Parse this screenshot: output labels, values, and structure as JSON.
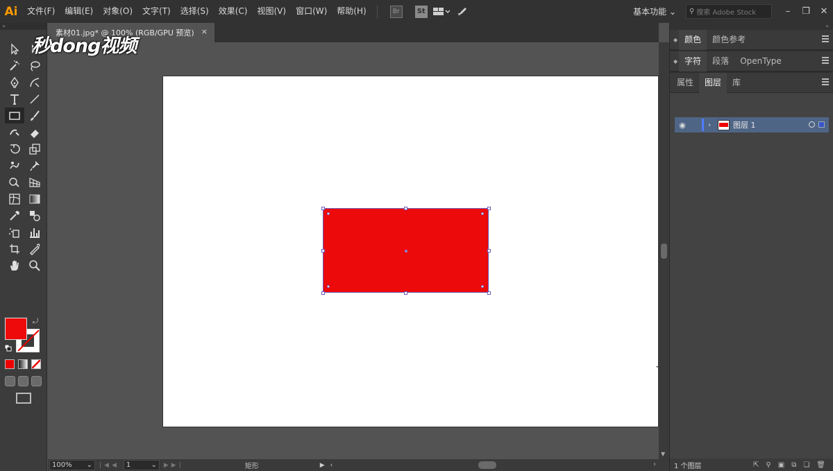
{
  "app": {
    "logo_text": "Ai"
  },
  "menu": [
    "文件(F)",
    "编辑(E)",
    "对象(O)",
    "文字(T)",
    "选择(S)",
    "效果(C)",
    "视图(V)",
    "窗口(W)",
    "帮助(H)"
  ],
  "menubar": {
    "bridge_label": "Br",
    "stock_label": "St",
    "workspace": "基本功能 ⌄",
    "search_placeholder": "搜索 Adobe Stock"
  },
  "watermark": "秒dong视频",
  "document": {
    "tab_title": "素材01.jpg* @ 100% (RGB/GPU 预览)",
    "close_glyph": "×"
  },
  "colors": {
    "fill": "#ee0a0a",
    "selection": "#6b5ab8",
    "layer_highlight": "#4f6585"
  },
  "status": {
    "zoom": "100%",
    "page": "1",
    "tool_name": "矩形"
  },
  "panels": {
    "group1": [
      "颜色",
      "颜色参考"
    ],
    "group2": [
      "字符",
      "段落",
      "OpenType"
    ],
    "group3": [
      "属性",
      "图层",
      "库"
    ],
    "layer_name": "图层 1",
    "layer_count": "1 个图层"
  }
}
